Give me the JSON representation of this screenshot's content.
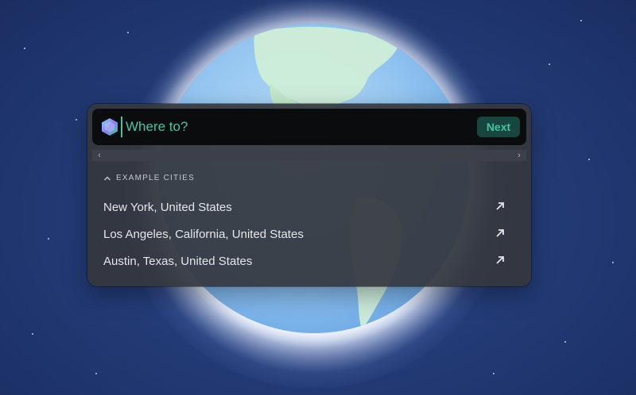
{
  "search": {
    "placeholder": "Where to?",
    "value": ""
  },
  "buttons": {
    "next_label": "Next"
  },
  "examples": {
    "header": "EXAMPLE CITIES",
    "items": [
      {
        "label": "New York, United States",
        "icon": "arrow-up-right-icon"
      },
      {
        "label": "Los Angeles, California, United States",
        "icon": "arrow-up-right-icon"
      },
      {
        "label": "Austin, Texas, United States",
        "icon": "arrow-up-right-icon"
      }
    ]
  },
  "icons": {
    "logo": "hexagon-logo-icon",
    "section_toggle": "chevron-up-icon",
    "scroll_left": "chevron-left-icon",
    "scroll_right": "chevron-right-icon"
  },
  "colors": {
    "accent": "#4ac2a3",
    "button_bg": "#16463d",
    "panel_bg": "#34373e",
    "input_bg": "#0b0c0e",
    "space_bg": "#243c78"
  }
}
